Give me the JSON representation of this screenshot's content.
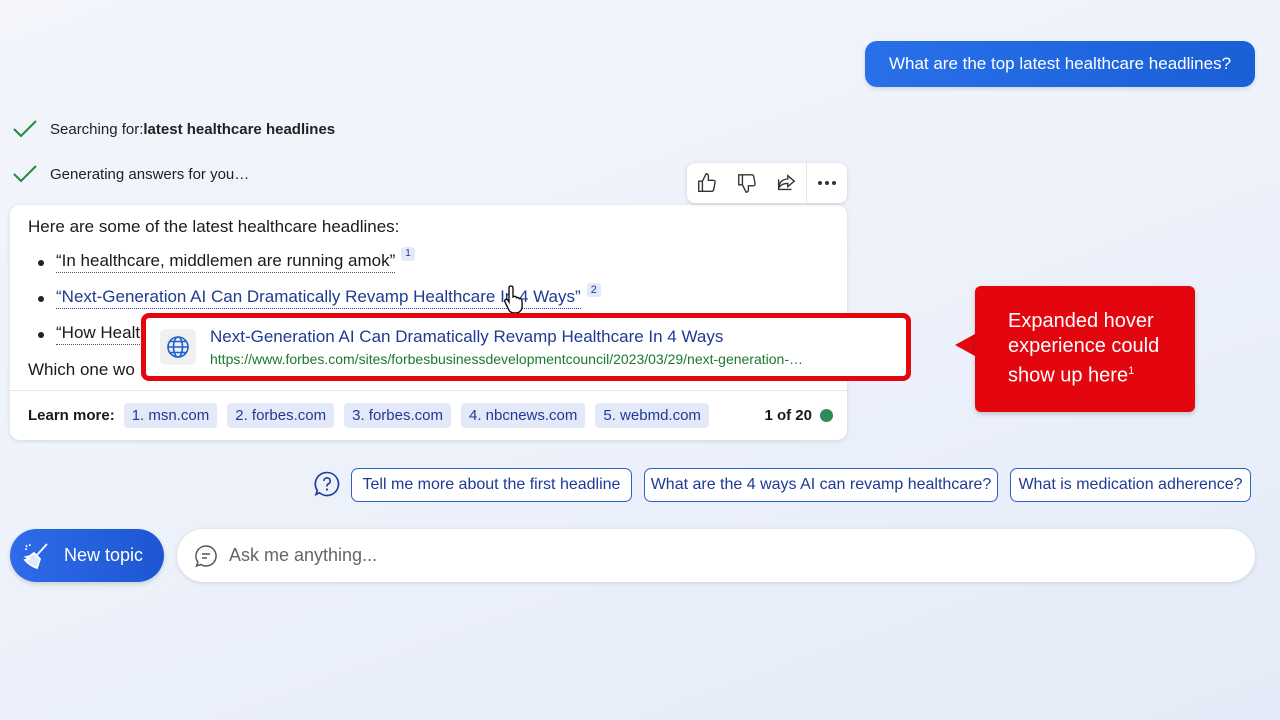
{
  "user_message": "What are the top latest healthcare headlines?",
  "status": {
    "searching_prefix": "Searching for: ",
    "searching_query": "latest healthcare headlines",
    "generating": "Generating answers for you…"
  },
  "actions": {
    "icons": [
      "thumbs-up-icon",
      "thumbs-down-icon",
      "share-icon",
      "more-icon"
    ]
  },
  "answer": {
    "intro": "Here are some of the latest healthcare headlines:",
    "headlines": [
      {
        "text": "“In healthcare, middlemen are running amok”",
        "cite": "1"
      },
      {
        "text": "“Next-Generation AI Can Dramatically Revamp Healthcare In 4 Ways”",
        "cite": "2"
      },
      {
        "text": "“How Healt",
        "cite": ""
      }
    ],
    "question": "Which one wo",
    "learn_more_label": "Learn more:",
    "sources": [
      "1. msn.com",
      "2. forbes.com",
      "3. forbes.com",
      "4. nbcnews.com",
      "5. webmd.com"
    ],
    "count": "1 of 20",
    "status_color": "#2e8b57"
  },
  "hover": {
    "title": "Next-Generation AI Can Dramatically Revamp Healthcare In 4 Ways",
    "url": "https://www.forbes.com/sites/forbesbusinessdevelopmentcouncil/2023/03/29/next-generation-…"
  },
  "callout": {
    "line1": "Expanded hover",
    "line2": "experience could",
    "line3": "show up here",
    "footnote": "1",
    "color": "#e3060f"
  },
  "suggestions": [
    "Tell me more about the first headline",
    "What are the 4 ways AI can revamp healthcare?",
    "What is medication adherence?"
  ],
  "composer": {
    "new_topic_label": "New topic",
    "placeholder": "Ask me anything..."
  }
}
